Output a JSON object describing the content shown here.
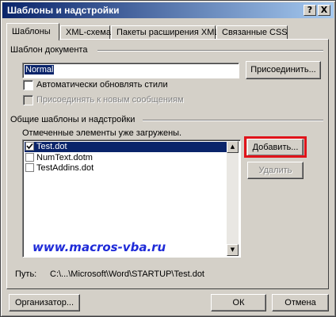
{
  "window": {
    "title": "Шаблоны и надстройки",
    "help_glyph": "?",
    "close_glyph": "X"
  },
  "tabs": [
    {
      "label": "Шаблоны"
    },
    {
      "label": "XML-схема"
    },
    {
      "label": "Пакеты расширения XML"
    },
    {
      "label": "Связанные CSS"
    }
  ],
  "document_template": {
    "group_label": "Шаблон документа",
    "value": "Normal",
    "attach_label": "Присоединить...",
    "auto_update_label": "Автоматически обновлять стили",
    "auto_update_checked": false,
    "attach_new_messages_label": "Присоединять к новым сообщениям",
    "attach_new_messages_enabled": false
  },
  "global_templates": {
    "group_label": "Общие шаблоны и надстройки",
    "info": "Отмеченные элементы уже загружены.",
    "items": [
      {
        "label": "Test.dot",
        "checked": true,
        "selected": true
      },
      {
        "label": "NumText.dotm",
        "checked": false,
        "selected": false
      },
      {
        "label": "TestAddins.dot",
        "checked": false,
        "selected": false
      }
    ],
    "add_label": "Добавить...",
    "remove_label": "Удалить",
    "scroll_up_glyph": "▲",
    "scroll_down_glyph": "▼"
  },
  "watermark": "www.macros-vba.ru",
  "path": {
    "label": "Путь:",
    "value": "C:\\...\\Microsoft\\Word\\STARTUP\\Test.dot"
  },
  "footer": {
    "organizer_label": "Организатор...",
    "ok_label": "ОК",
    "cancel_label": "Отмена"
  },
  "colors": {
    "highlight": "#e0131a",
    "watermark": "#1e2ad8",
    "selection": "#0a246a"
  }
}
